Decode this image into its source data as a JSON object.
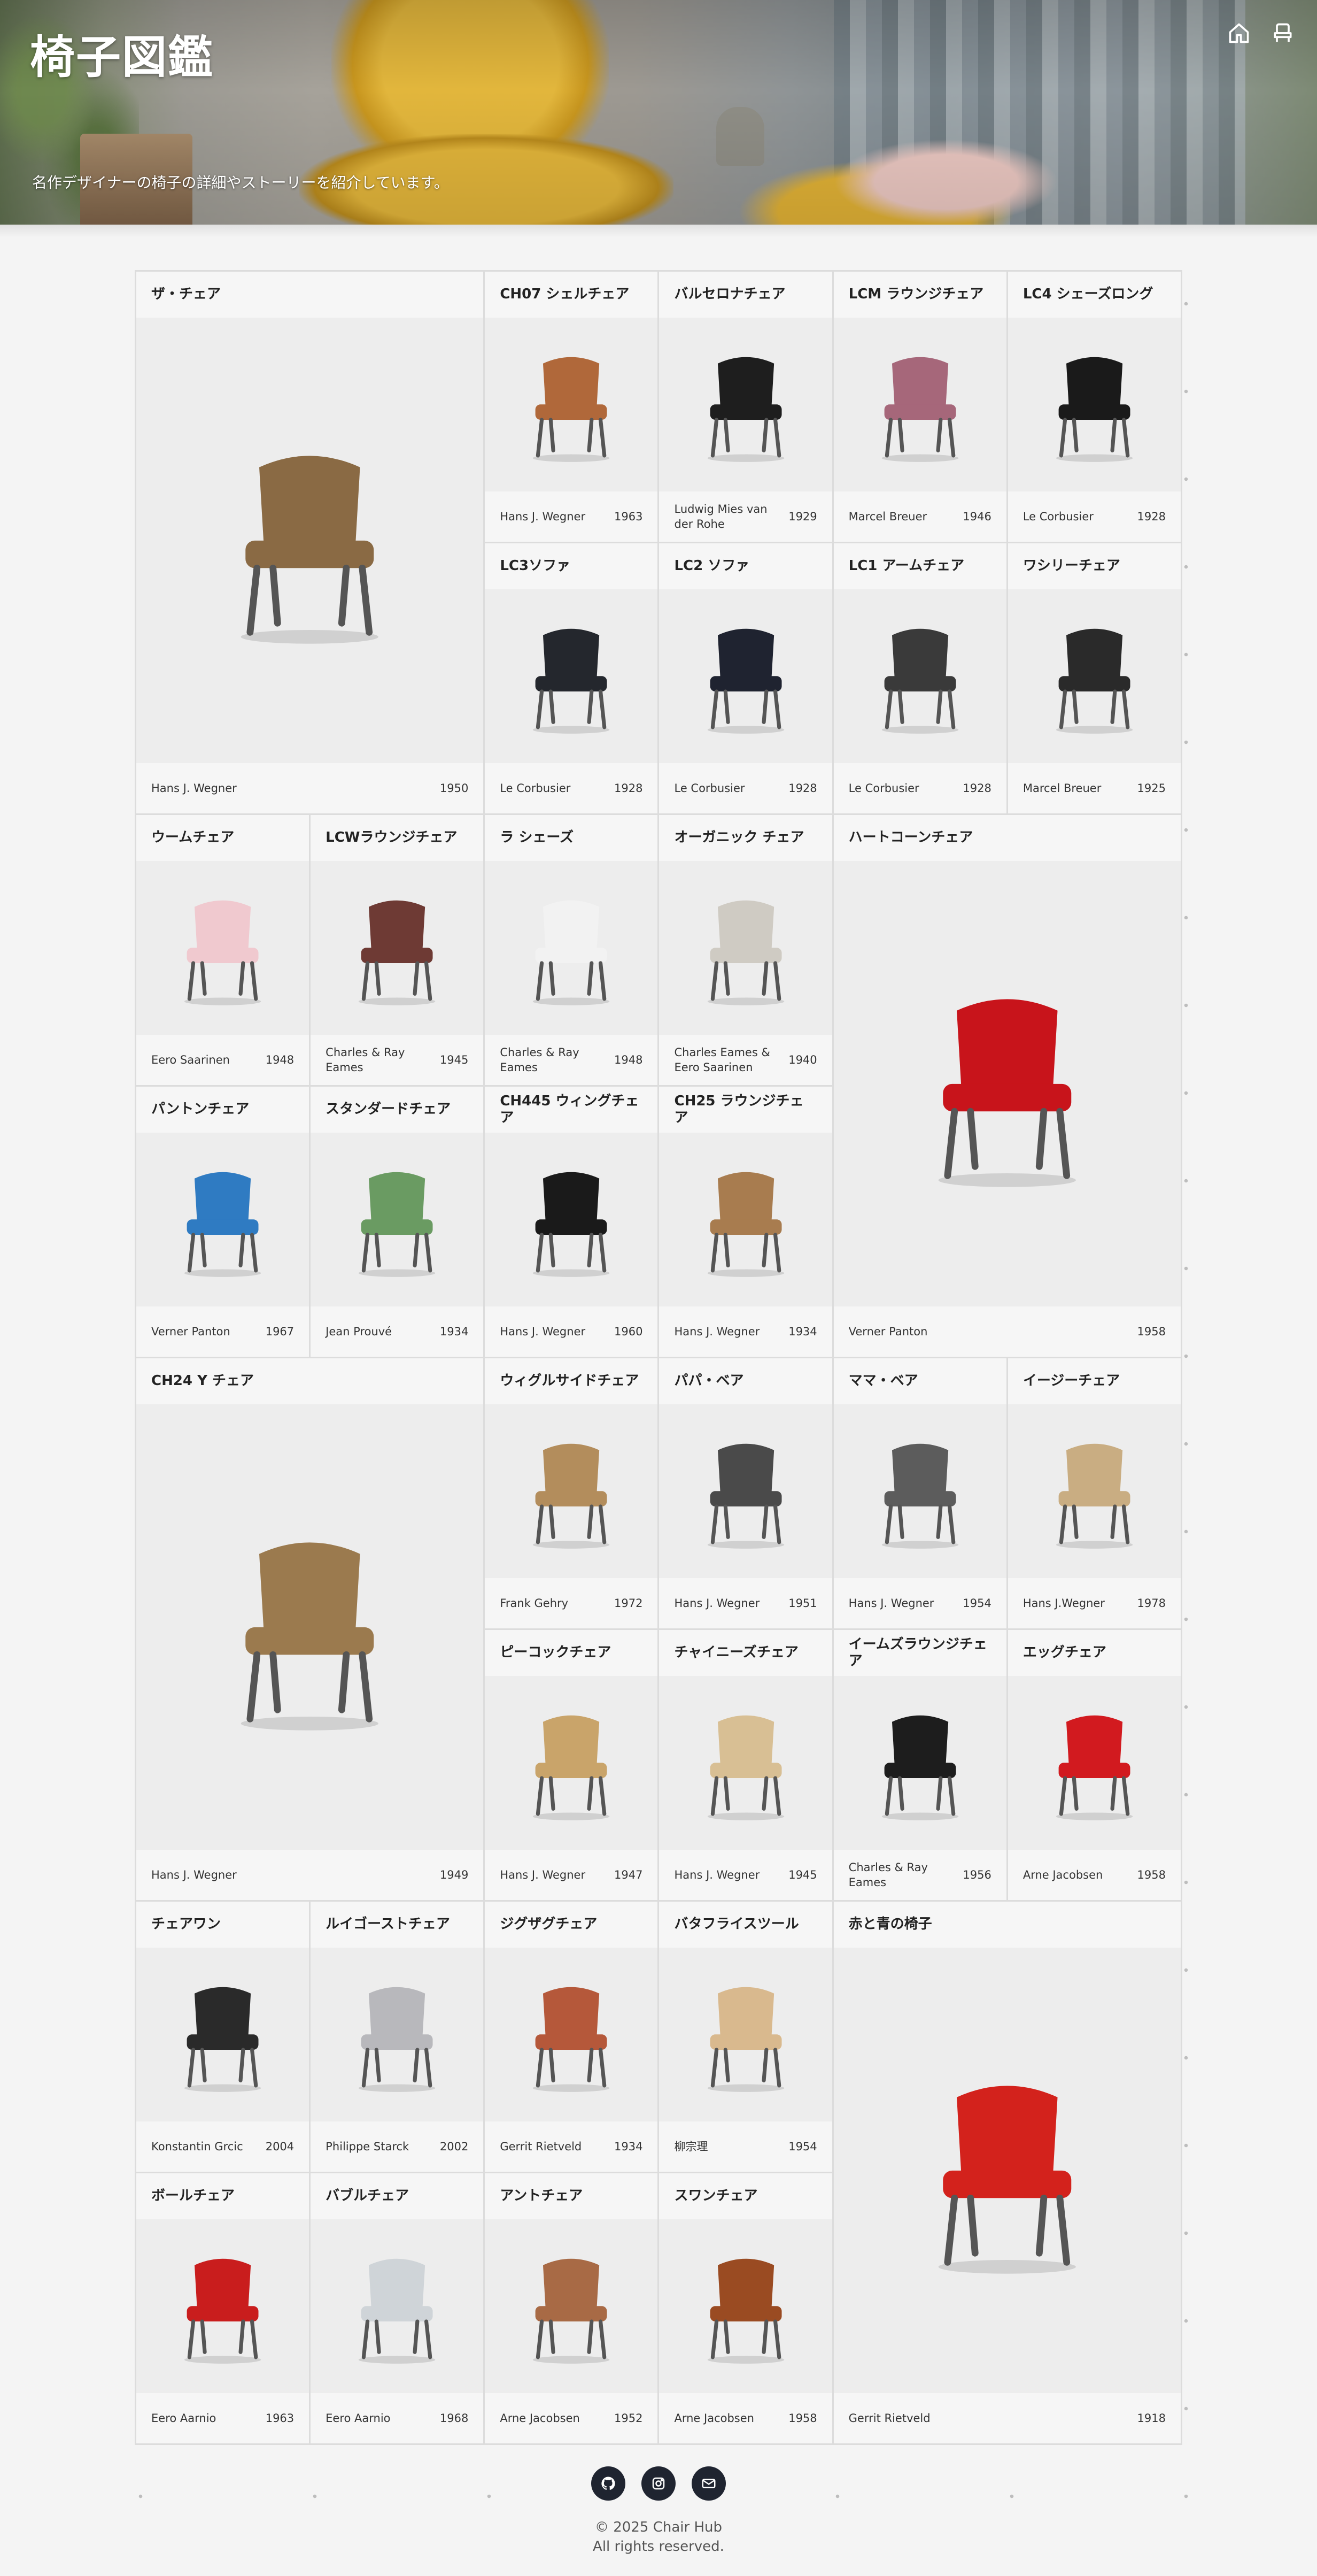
{
  "header": {
    "title": "椅子図鑑",
    "tagline": "名作デザイナーの椅子の詳細やストーリーを紹介しています。",
    "icons": [
      "home-icon",
      "chair-icon"
    ]
  },
  "chairs": [
    {
      "name": "ザ・チェア",
      "designer": "Hans J. Wegner",
      "year": "1950",
      "color": "#8a6a44"
    },
    {
      "name": "CH07 シェルチェア",
      "designer": "Hans J. Wegner",
      "year": "1963",
      "color": "#b0683a"
    },
    {
      "name": "バルセロナチェア",
      "designer": "Ludwig Mies van der Rohe",
      "year": "1929",
      "color": "#1e1e1e"
    },
    {
      "name": "LCM ラウンジチェア",
      "designer": "Marcel Breuer",
      "year": "1946",
      "color": "#a6677a"
    },
    {
      "name": "LC4 シェーズロング",
      "designer": "Le Corbusier",
      "year": "1928",
      "color": "#1a1a1a"
    },
    {
      "name": "LC3ソファ",
      "designer": "Le Corbusier",
      "year": "1928",
      "color": "#24272d"
    },
    {
      "name": "LC2 ソファ",
      "designer": "Le Corbusier",
      "year": "1928",
      "color": "#1f2330"
    },
    {
      "name": "LC1 アームチェア",
      "designer": "Le Corbusier",
      "year": "1928",
      "color": "#3a3a3a"
    },
    {
      "name": "ワシリーチェア",
      "designer": "Marcel Breuer",
      "year": "1925",
      "color": "#2a2a2a"
    },
    {
      "name": "ウームチェア",
      "designer": "Eero Saarinen",
      "year": "1948",
      "color": "#f0c9cf"
    },
    {
      "name": "LCWラウンジチェア",
      "designer": "Charles & Ray Eames",
      "year": "1945",
      "color": "#6e3a34"
    },
    {
      "name": "ラ シェーズ",
      "designer": "Charles & Ray Eames",
      "year": "1948",
      "color": "#f2f2f2"
    },
    {
      "name": "オーガニック チェア",
      "designer": "Charles Eames & Eero Saarinen",
      "year": "1940",
      "color": "#cfcbc3"
    },
    {
      "name": "ハートコーンチェア",
      "designer": "Verner Panton",
      "year": "1958",
      "color": "#c8141b"
    },
    {
      "name": "パントンチェア",
      "designer": "Verner Panton",
      "year": "1967",
      "color": "#2f7bc2"
    },
    {
      "name": "スタンダードチェア",
      "designer": "Jean Prouvé",
      "year": "1934",
      "color": "#6a9b62"
    },
    {
      "name": "CH445 ウィングチェア",
      "designer": "Hans J. Wegner",
      "year": "1960",
      "color": "#1a1a1a"
    },
    {
      "name": "CH25 ラウンジチェア",
      "designer": "Hans J. Wegner",
      "year": "1934",
      "color": "#a87c4f"
    },
    {
      "name": "CH24 Y チェア",
      "designer": "Hans J. Wegner",
      "year": "1949",
      "color": "#9b7a4e"
    },
    {
      "name": "ウィグルサイドチェア",
      "designer": "Frank Gehry",
      "year": "1972",
      "color": "#b38d5c"
    },
    {
      "name": "パパ・ベア",
      "designer": "Hans J. Wegner",
      "year": "1951",
      "color": "#4a4a4a"
    },
    {
      "name": "ママ・ベア",
      "designer": "Hans J. Wegner",
      "year": "1954",
      "color": "#5c5c5c"
    },
    {
      "name": "イージーチェア",
      "designer": "Hans J.Wegner",
      "year": "1978",
      "color": "#c9ad82"
    },
    {
      "name": "ピーコックチェア",
      "designer": "Hans J. Wegner",
      "year": "1947",
      "color": "#c9a46a"
    },
    {
      "name": "チャイニーズチェア",
      "designer": "Hans J. Wegner",
      "year": "1945",
      "color": "#d8bf94"
    },
    {
      "name": "イームズラウンジチェア",
      "designer": "Charles & Ray Eames",
      "year": "1956",
      "color": "#1d1d1d"
    },
    {
      "name": "エッグチェア",
      "designer": "Arne Jacobsen",
      "year": "1958",
      "color": "#d21a1f"
    },
    {
      "name": "チェアワン",
      "designer": "Konstantin Grcic",
      "year": "2004",
      "color": "#2a2a2a"
    },
    {
      "name": "ルイゴーストチェア",
      "designer": "Philippe Starck",
      "year": "2002",
      "color": "#b8b8bc"
    },
    {
      "name": "ジグザグチェア",
      "designer": "Gerrit Rietveld",
      "year": "1934",
      "color": "#b5583a"
    },
    {
      "name": "バタフライスツール",
      "designer": "柳宗理",
      "year": "1954",
      "color": "#d9b98e"
    },
    {
      "name": "赤と青の椅子",
      "designer": "Gerrit Rietveld",
      "year": "1918",
      "color": "#d3221c"
    },
    {
      "name": "ボールチェア",
      "designer": "Eero Aarnio",
      "year": "1963",
      "color": "#c91d1d"
    },
    {
      "name": "バブルチェア",
      "designer": "Eero Aarnio",
      "year": "1968",
      "color": "#cfd4d8"
    },
    {
      "name": "アントチェア",
      "designer": "Arne Jacobsen",
      "year": "1952",
      "color": "#a86a45"
    },
    {
      "name": "スワンチェア",
      "designer": "Arne Jacobsen",
      "year": "1958",
      "color": "#9a4b22"
    }
  ],
  "footer": {
    "icons": [
      "github-icon",
      "instagram-icon",
      "mail-icon"
    ],
    "copyright": "© 2025 Chair Hub",
    "rights": "All rights reserved."
  }
}
